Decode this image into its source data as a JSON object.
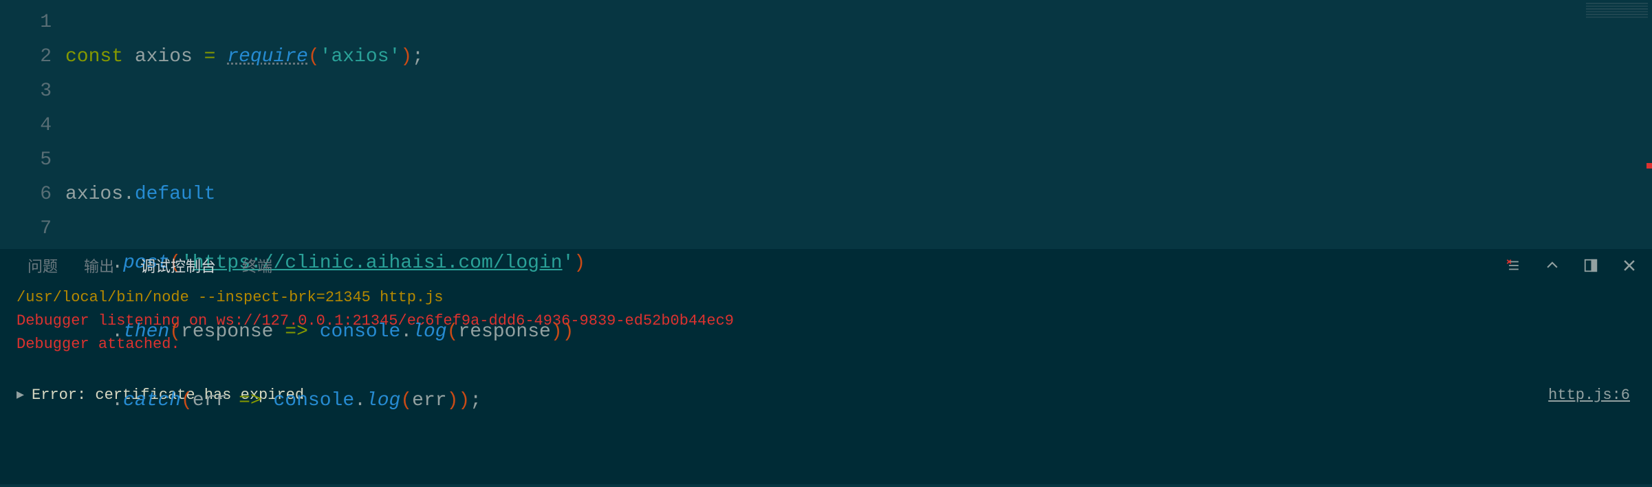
{
  "editor": {
    "lines": [
      1,
      2,
      3,
      4,
      5,
      6,
      7
    ],
    "code": {
      "l1": {
        "keyword": "const ",
        "varName": "axios ",
        "eq": "= ",
        "fn": "require",
        "lp": "(",
        "str": "'axios'",
        "rp": ")",
        "semi": ";"
      },
      "l3": {
        "obj": "axios",
        "dot": ".",
        "prop": "default"
      },
      "l4": {
        "dot": ".",
        "method": "post",
        "lp": "(",
        "q1": "'",
        "url": "https://clinic.aihaisi.com/login",
        "q2": "'",
        "rp": ")"
      },
      "l5": {
        "dot": ".",
        "method": "then",
        "lp": "(",
        "param": "response ",
        "arrow": "=> ",
        "console": "console",
        "dot2": ".",
        "log": "log",
        "lp2": "(",
        "arg": "response",
        "rp2": ")",
        "rp": ")"
      },
      "l6": {
        "dot": ".",
        "method": "catch",
        "lp": "(",
        "param": "err ",
        "arrow": "=> ",
        "console": "console",
        "dot2": ".",
        "log": "log",
        "lp2": "(",
        "arg": "err",
        "rp2": ")",
        "rp": ")",
        "semi": ";"
      }
    }
  },
  "panel": {
    "tabs": {
      "problems": "问题",
      "output": "输出",
      "debugConsole": "调试控制台",
      "terminal": "终端"
    },
    "icons": {
      "clear": "clear-console-icon",
      "collapse": "collapse-icon",
      "layout": "panel-layout-icon",
      "close": "close-icon"
    }
  },
  "console": {
    "cmd": "/usr/local/bin/node --inspect-brk=21345 http.js",
    "listening": "Debugger listening on ws://127.0.0.1:21345/ec6fef9a-ddd6-4936-9839-ed52b0b44ec9",
    "attached": "Debugger attached.",
    "error": "Error: certificate has expired",
    "errorSource": "http.js:6"
  }
}
